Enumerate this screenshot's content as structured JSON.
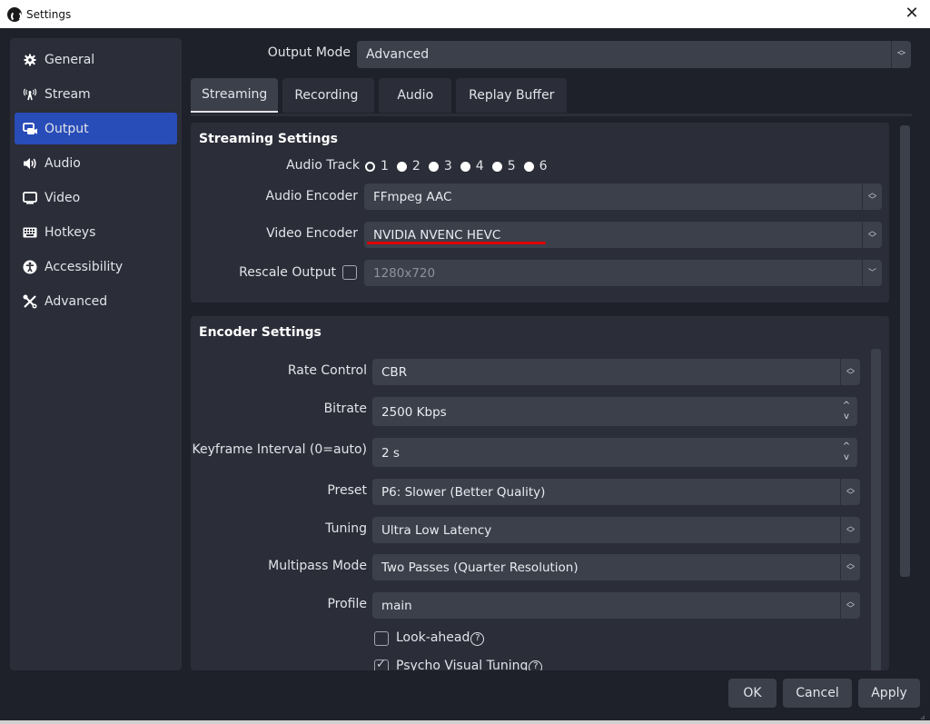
{
  "window": {
    "title": "Settings",
    "close_icon": "close-icon"
  },
  "sidebar": {
    "items": [
      {
        "label": "General",
        "icon": "gear-icon",
        "glyph": "✿",
        "active": false
      },
      {
        "label": "Stream",
        "icon": "antenna-icon",
        "glyph": "📡",
        "active": false
      },
      {
        "label": "Output",
        "icon": "output-icon",
        "glyph": "▣",
        "active": true
      },
      {
        "label": "Audio",
        "icon": "speaker-icon",
        "glyph": "🔊",
        "active": false
      },
      {
        "label": "Video",
        "icon": "monitor-icon",
        "glyph": "▭",
        "active": false
      },
      {
        "label": "Hotkeys",
        "icon": "keyboard-icon",
        "glyph": "⌨",
        "active": false
      },
      {
        "label": "Accessibility",
        "icon": "accessibility-icon",
        "glyph": "♿",
        "active": false
      },
      {
        "label": "Advanced",
        "icon": "tools-icon",
        "glyph": "✂",
        "active": false
      }
    ]
  },
  "output_mode": {
    "label": "Output Mode",
    "value": "Advanced"
  },
  "tabs": [
    {
      "label": "Streaming",
      "active": true
    },
    {
      "label": "Recording",
      "active": false
    },
    {
      "label": "Audio",
      "active": false
    },
    {
      "label": "Replay Buffer",
      "active": false
    }
  ],
  "streaming_settings": {
    "title": "Streaming Settings",
    "audio_track": {
      "label": "Audio Track",
      "options": [
        "1",
        "2",
        "3",
        "4",
        "5",
        "6"
      ],
      "selected": "1"
    },
    "audio_encoder": {
      "label": "Audio Encoder",
      "value": "FFmpeg AAC"
    },
    "video_encoder": {
      "label": "Video Encoder",
      "value": "NVIDIA NVENC HEVC",
      "annotation_color": "#e00000"
    },
    "rescale_output": {
      "label": "Rescale Output",
      "checked": false,
      "value": "1280x720"
    }
  },
  "encoder_settings": {
    "title": "Encoder Settings",
    "rate_control": {
      "label": "Rate Control",
      "value": "CBR"
    },
    "bitrate": {
      "label": "Bitrate",
      "value": "2500 Kbps"
    },
    "keyframe_interval": {
      "label": "Keyframe Interval (0=auto)",
      "value": "2 s"
    },
    "preset": {
      "label": "Preset",
      "value": "P6: Slower (Better Quality)"
    },
    "tuning": {
      "label": "Tuning",
      "value": "Ultra Low Latency"
    },
    "multipass_mode": {
      "label": "Multipass Mode",
      "value": "Two Passes (Quarter Resolution)"
    },
    "profile": {
      "label": "Profile",
      "value": "main"
    },
    "look_ahead": {
      "label": "Look-ahead",
      "checked": false,
      "help": "?"
    },
    "psycho_visual_tuning": {
      "label": "Psycho Visual Tuning",
      "checked": true,
      "help": "?"
    }
  },
  "buttons": {
    "ok": "OK",
    "cancel": "Cancel",
    "apply": "Apply"
  },
  "colors": {
    "accent": "#284cb8",
    "background": "#1f212a",
    "panel": "#2b2d38",
    "field": "#3c404b"
  }
}
